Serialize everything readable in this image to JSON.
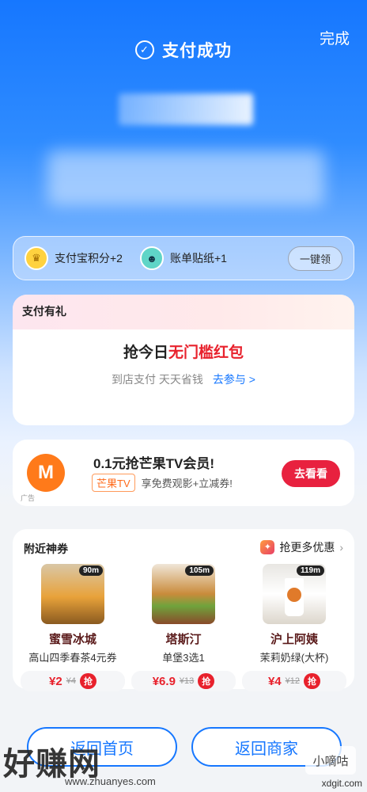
{
  "header": {
    "title": "支付成功",
    "done_label": "完成"
  },
  "rewards": {
    "points_label": "支付宝积分+2",
    "sticker_label": "账单贴纸+1",
    "claim_label": "一键领"
  },
  "gift": {
    "header": "支付有礼",
    "main_prefix": "抢今日",
    "main_highlight": "无门槛红包",
    "sub_text": "到店支付 天天省钱",
    "join_link": "去参与 >"
  },
  "ad": {
    "tag": "广告",
    "title": "0.1元抢芒果TV会员!",
    "badge": "芒果TV",
    "subtitle": "享免费观影+立减券!",
    "button": "去看看"
  },
  "nearby": {
    "title": "附近神券",
    "more_label": "抢更多优惠",
    "items": [
      {
        "distance": "90m",
        "name": "蜜雪冰城",
        "desc": "高山四季春茶4元券",
        "price": "¥2",
        "old_price": "¥4",
        "grab": "抢"
      },
      {
        "distance": "105m",
        "name": "塔斯汀",
        "desc": "单堡3选1",
        "price": "¥6.9",
        "old_price": "¥13",
        "grab": "抢"
      },
      {
        "distance": "119m",
        "name": "沪上阿姨",
        "desc": "茉莉奶绿(大杯)",
        "price": "¥4",
        "old_price": "¥12",
        "grab": "抢"
      }
    ]
  },
  "footer": {
    "home_label": "返回首页",
    "merchant_label": "返回商家"
  },
  "watermark": {
    "left_text": "好赚网",
    "url": "www.zhuanyes.com",
    "right_logo": "小嘀咕",
    "right_url": "xdgit.com"
  }
}
